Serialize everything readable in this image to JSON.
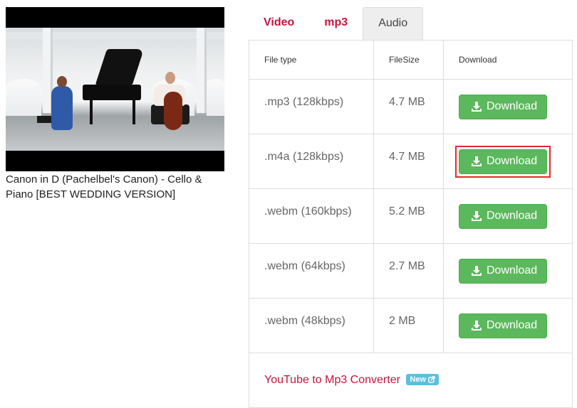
{
  "video": {
    "title": "Canon in D (Pachelbel's Canon) - Cello & Piano [BEST WEDDING VERSION]",
    "thumbnail_description": "Pianist at grand piano and cellist in white industrial hall"
  },
  "tabs": [
    {
      "label": "Video",
      "active": false
    },
    {
      "label": "mp3",
      "active": false
    },
    {
      "label": "Audio",
      "active": true
    }
  ],
  "table": {
    "headers": [
      "File type",
      "FileSize",
      "Download"
    ],
    "rows": [
      {
        "file_type": ".mp3 (128kbps)",
        "size": "4.7 MB",
        "button": "Download",
        "highlighted": false
      },
      {
        "file_type": ".m4a (128kbps)",
        "size": "4.7 MB",
        "button": "Download",
        "highlighted": true
      },
      {
        "file_type": ".webm (160kbps)",
        "size": "5.2 MB",
        "button": "Download",
        "highlighted": false
      },
      {
        "file_type": ".webm (64kbps)",
        "size": "2.7 MB",
        "button": "Download",
        "highlighted": false
      },
      {
        "file_type": ".webm (48kbps)",
        "size": "2 MB",
        "button": "Download",
        "highlighted": false
      }
    ],
    "footer": {
      "link_text": "YouTube to Mp3 Converter",
      "badge": "New",
      "badge_icon": "external-link-icon"
    }
  },
  "colors": {
    "tab_link": "#c4163c",
    "download_button": "#5cb85c",
    "badge": "#5bc0de",
    "highlight": "#e32a2a"
  }
}
